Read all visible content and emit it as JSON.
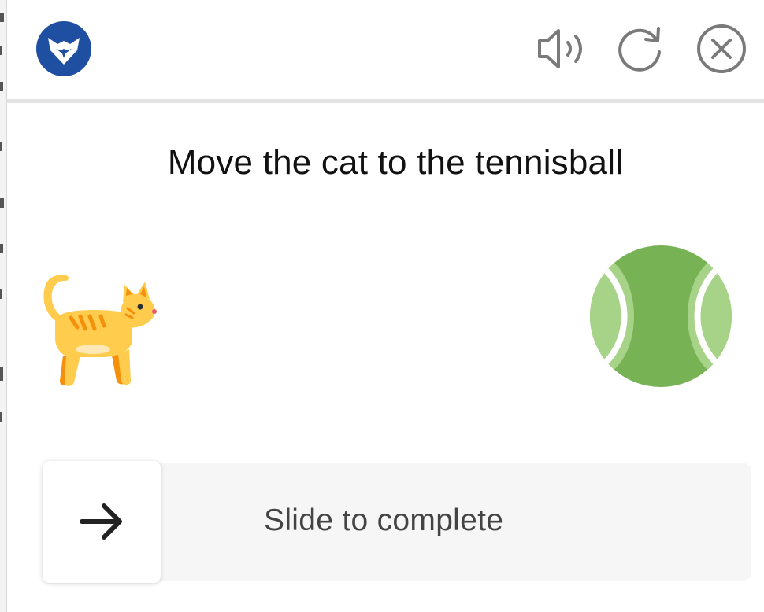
{
  "header": {
    "logo_icon": "fox-shield-logo-icon",
    "audio_icon": "speaker-icon",
    "refresh_icon": "refresh-icon",
    "close_icon": "close-circle-icon"
  },
  "challenge": {
    "instruction": "Move the cat to the tennisball",
    "source_icon": "cat-icon",
    "target_icon": "tennis-ball-icon"
  },
  "slider": {
    "label": "Slide to complete",
    "handle_icon": "arrow-right-icon",
    "progress": 0
  },
  "colors": {
    "brand": "#1F4FA0",
    "icon_gray": "#7a7a7a",
    "ball_green": "#77B255",
    "ball_light": "#A6D388",
    "cat_body": "#FFCC4D",
    "cat_stripes": "#F4900C"
  }
}
